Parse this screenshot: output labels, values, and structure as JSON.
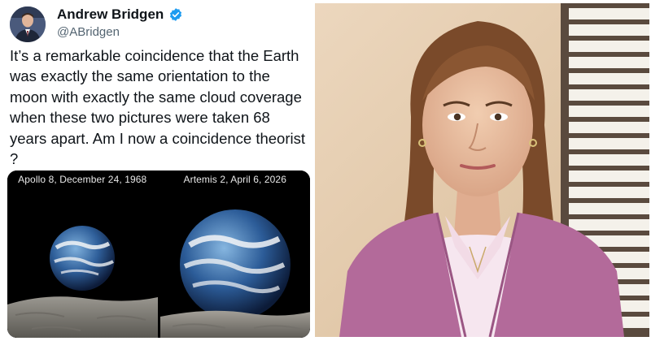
{
  "tweet": {
    "author_name": "Andrew Bridgen",
    "author_handle": "@ABridgen",
    "verified_icon": "verified-badge-icon",
    "text": "It’s a remarkable coincidence that the Earth was exactly the same orientation to the moon with exactly the same cloud coverage when these two pictures were taken 68 years apart. Am I now a coincidence theorist ?",
    "media": [
      {
        "caption": "Apollo 8, December 24, 1968"
      },
      {
        "caption": "Artemis 2, April 6, 2026"
      }
    ]
  },
  "colors": {
    "name": "#0f1419",
    "handle": "#536471",
    "verified": "#1d9bf0",
    "cardigan": "#b36a9a",
    "wall": "#e4ccb0"
  }
}
